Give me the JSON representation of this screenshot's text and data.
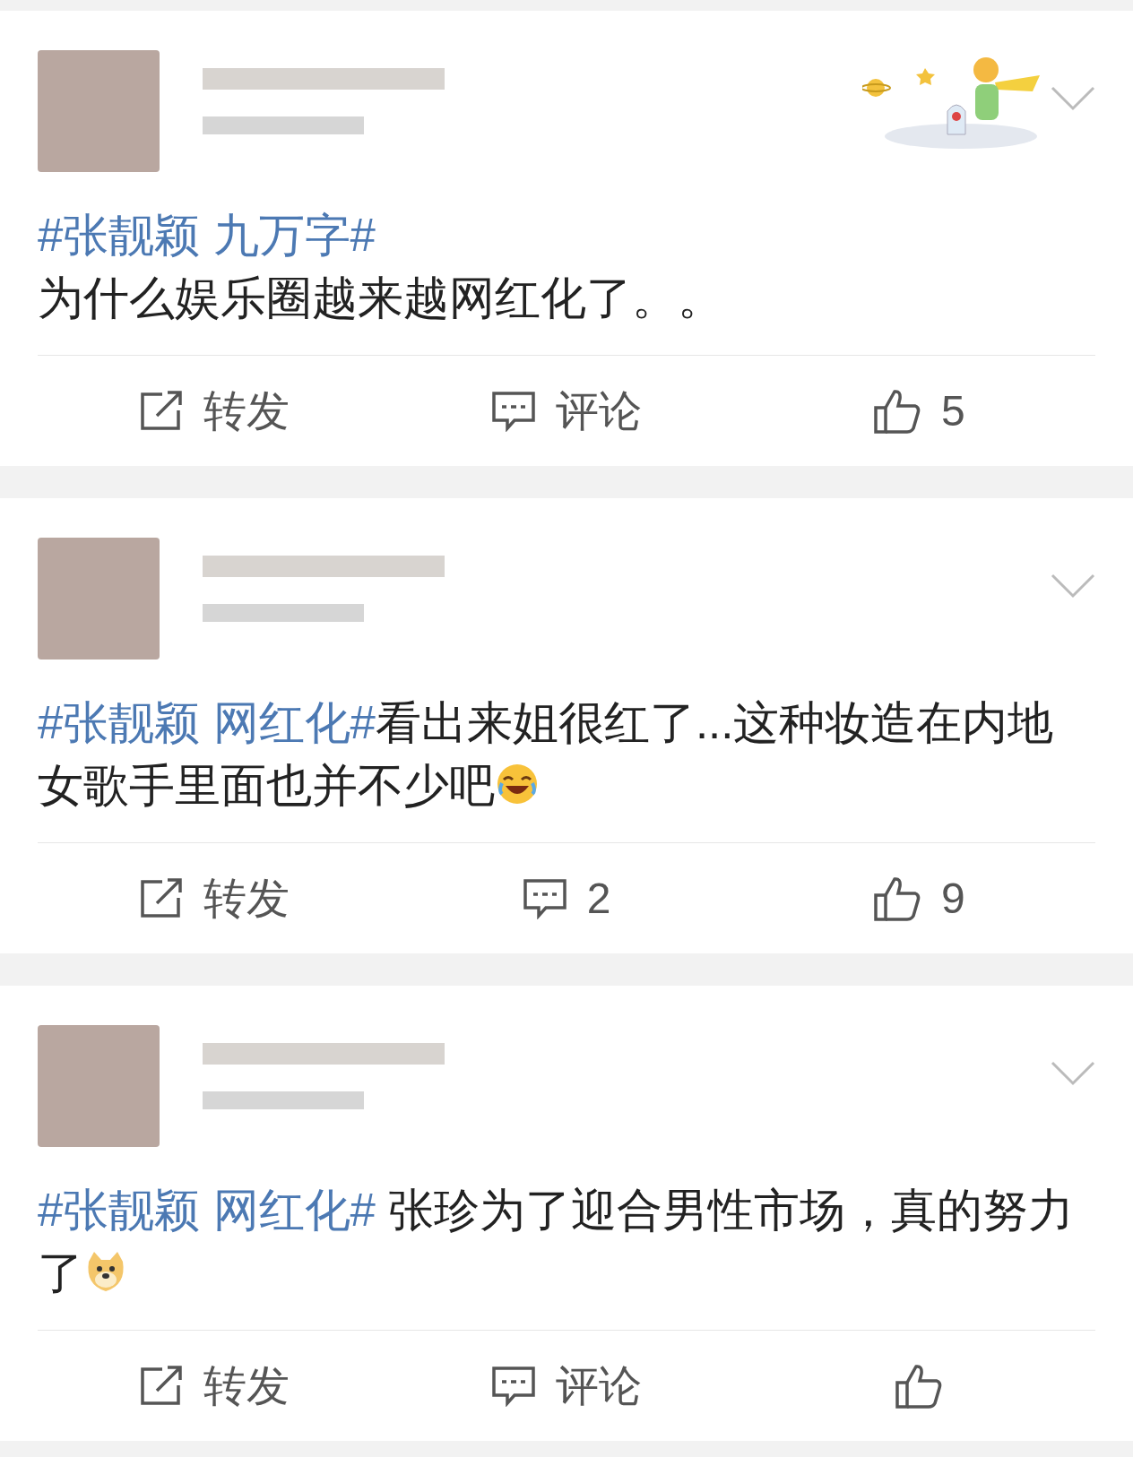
{
  "posts": [
    {
      "decoration": true,
      "hashtag": "#张靓颖 九万字#",
      "hashtag_own_line": true,
      "text": "为什么娱乐圈越来越网红化了。。",
      "actions": [
        {
          "kind": "repost",
          "label": "转发"
        },
        {
          "kind": "comment",
          "label": "评论"
        },
        {
          "kind": "like",
          "label": "5"
        }
      ]
    },
    {
      "decoration": false,
      "hashtag": "#张靓颖 网红化#",
      "hashtag_own_line": false,
      "text": "看出来姐很红了...这种妆造在内地女歌手里面也并不少吧",
      "emoji": {
        "kind": "laugh"
      },
      "actions": [
        {
          "kind": "repost",
          "label": "转发"
        },
        {
          "kind": "comment",
          "label": "2"
        },
        {
          "kind": "like",
          "label": "9"
        }
      ]
    },
    {
      "decoration": false,
      "hashtag": "#张靓颖 网红化#",
      "hashtag_own_line": false,
      "text": " 张珍为了迎合男性市场，真的努力了",
      "emoji": {
        "kind": "doge"
      },
      "actions": [
        {
          "kind": "repost",
          "label": "转发"
        },
        {
          "kind": "comment",
          "label": "评论"
        },
        {
          "kind": "like"
        }
      ]
    }
  ]
}
